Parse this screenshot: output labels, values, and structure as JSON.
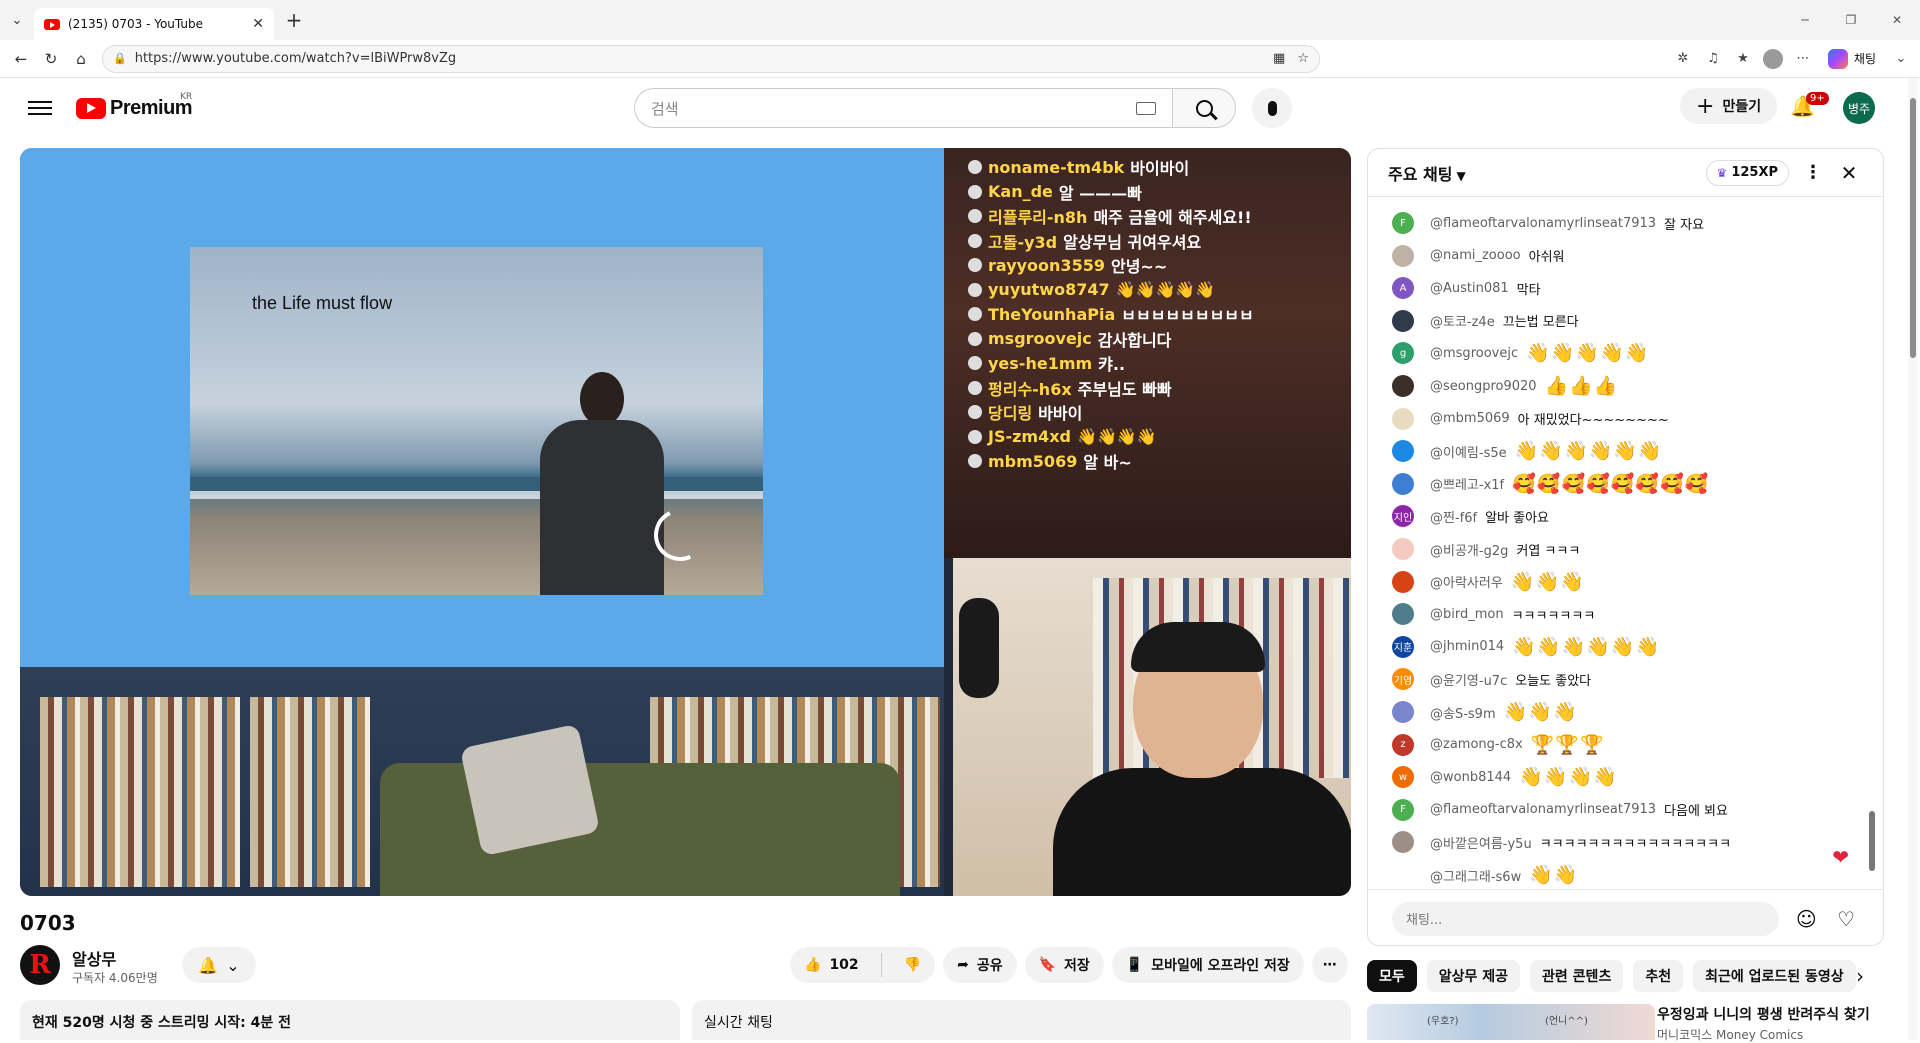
{
  "browser": {
    "tab_title": "(2135) 0703 - YouTube",
    "url": "https://www.youtube.com/watch?v=lBiWPrw8vZg",
    "copilot_label": "채팅"
  },
  "yt_header": {
    "logo_text": "Premium",
    "region": "KR",
    "search_placeholder": "검색",
    "create_label": "만들기",
    "notif_count": "9+",
    "avatar_text": "병주"
  },
  "video": {
    "slide_caption": "the Life must flow",
    "overlay_chat": [
      {
        "name": "noname-tm4bk",
        "msg": "바이바이"
      },
      {
        "name": "Kan_de",
        "msg": "알 ———빠"
      },
      {
        "name": "리플루리-n8h",
        "msg": "매주 금욜에 해주세요!!"
      },
      {
        "name": "고돌-y3d",
        "msg": "알상무님 귀여우셔요"
      },
      {
        "name": "rayyoon3559",
        "msg": "안녕~~"
      },
      {
        "name": "yuyutwo8747",
        "msg": "👋👋👋👋👋"
      },
      {
        "name": "TheYounhaPia",
        "msg": "ㅂㅂㅂㅂㅂㅂㅂㅂㅂ"
      },
      {
        "name": "msgroovejc",
        "msg": "감사합니다"
      },
      {
        "name": "yes-he1mm",
        "msg": "캬.."
      },
      {
        "name": "펑리수-h6x",
        "msg": "주부님도 빠빠"
      },
      {
        "name": "당디링",
        "msg": "바바이"
      },
      {
        "name": "JS-zm4xd",
        "msg": "👋👋👋👋"
      },
      {
        "name": "mbm5069",
        "msg": "알 바~"
      }
    ],
    "title": "0703",
    "channel_name": "알상무",
    "channel_subs": "구독자 4.06만명",
    "likes": "102",
    "share_label": "공유",
    "save_label": "저장",
    "offline_label": "모바일에 오프라인 저장",
    "desc_summary": "현재 520명 시청 중  스트리밍 시작: 4분 전",
    "live_chat_label": "실시간 채팅"
  },
  "chat": {
    "header_title": "주요 채팅",
    "xp": "125XP",
    "messages": [
      {
        "author": "@flameoftarvalonamyrlinseat7913",
        "text": "잘 자요",
        "avatar_letter": "F",
        "avatar_color": "#4caf50",
        "emoji": false
      },
      {
        "author": "@nami_zoooo",
        "text": "아쉬워",
        "avatar_letter": "",
        "avatar_color": "#bfb3a6",
        "emoji": false
      },
      {
        "author": "@Austin081",
        "text": "막타",
        "avatar_letter": "A",
        "avatar_color": "#7e57c2",
        "emoji": false
      },
      {
        "author": "@토코-z4e",
        "text": "끄는법 모른다",
        "avatar_letter": "",
        "avatar_color": "#2d3b4a",
        "emoji": false
      },
      {
        "author": "@msgroovejc",
        "text": "👋👋👋👋👋",
        "avatar_letter": "g",
        "avatar_color": "#2e9e6b",
        "emoji": true
      },
      {
        "author": "@seongpro9020",
        "text": "👍👍👍",
        "avatar_letter": "",
        "avatar_color": "#3b2f2a",
        "emoji": true
      },
      {
        "author": "@mbm5069",
        "text": "아 재밌었다~~~~~~~~",
        "avatar_letter": "",
        "avatar_color": "#e8dcc0",
        "emoji": false
      },
      {
        "author": "@이예림-s5e",
        "text": "👋👋👋👋👋👋",
        "avatar_letter": "",
        "avatar_color": "#1e88e5",
        "emoji": true
      },
      {
        "author": "@쁘레고-x1f",
        "text": "🥰🥰🥰🥰🥰🥰🥰🥰",
        "avatar_letter": "",
        "avatar_color": "#3f7fd1",
        "emoji": true
      },
      {
        "author": "@찐-f6f",
        "text": "알바 좋아요",
        "avatar_letter": "지인",
        "avatar_color": "#8e24aa",
        "emoji": false
      },
      {
        "author": "@비공개-g2g",
        "text": "커엽 ㅋㅋㅋ",
        "avatar_letter": "",
        "avatar_color": "#f3c9c0",
        "emoji": false
      },
      {
        "author": "@아락사러우",
        "text": "👋👋👋",
        "avatar_letter": "",
        "avatar_color": "#d84315",
        "emoji": true
      },
      {
        "author": "@bird_mon",
        "text": "ㅋㅋㅋㅋㅋㅋㅋ",
        "avatar_letter": "",
        "avatar_color": "#4f7d8c",
        "emoji": false
      },
      {
        "author": "@jhmin014",
        "text": "👋👋👋👋👋👋",
        "avatar_letter": "지훈",
        "avatar_color": "#0d47a1",
        "emoji": true
      },
      {
        "author": "@윤기영-u7c",
        "text": "오늘도 좋았다",
        "avatar_letter": "기영",
        "avatar_color": "#fb8c00",
        "emoji": false
      },
      {
        "author": "@송S-s9m",
        "text": "👋👋👋",
        "avatar_letter": "",
        "avatar_color": "#7986cb",
        "emoji": true
      },
      {
        "author": "@zamong-c8x",
        "text": "🏆🏆🏆",
        "avatar_letter": "z",
        "avatar_color": "#c0392b",
        "emoji": true
      },
      {
        "author": "@wonb8144",
        "text": "👋👋👋👋",
        "avatar_letter": "w",
        "avatar_color": "#ef6c00",
        "emoji": true
      },
      {
        "author": "@flameoftarvalonamyrlinseat7913",
        "text": "다음에 뵈요",
        "avatar_letter": "F",
        "avatar_color": "#4caf50",
        "emoji": false
      },
      {
        "author": "@바깥은여름-y5u",
        "text": "ㅋㅋㅋㅋㅋㅋㅋㅋㅋㅋㅋㅋㅋㅋㅋㅋ",
        "avatar_letter": "",
        "avatar_color": "#9c8f86",
        "emoji": false
      },
      {
        "author": "@그래그래-s6w",
        "text": "👋👋",
        "avatar_letter": "",
        "avatar_color": "#ffffff",
        "emoji": true
      }
    ],
    "input_placeholder": "채팅..."
  },
  "chips": [
    "모두",
    "알상무 제공",
    "관련 콘텐츠",
    "추천",
    "최근에 업로드된 동영상"
  ],
  "reco": {
    "thumb_left": "(우호?)",
    "thumb_right": "(언니^^)",
    "title": "우정잉과 니니의 평생 반려주식 찾기",
    "channel": "머니코믹스 Money Comics"
  }
}
